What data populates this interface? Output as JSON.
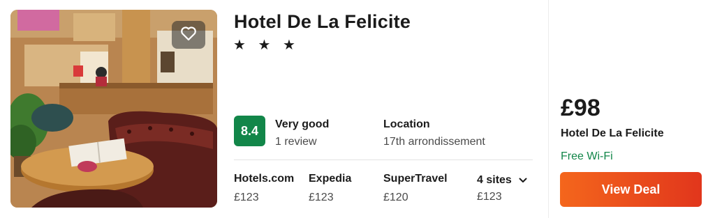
{
  "hotel": {
    "name": "Hotel De La Felicite",
    "stars": "★ ★ ★",
    "favorite_icon": "heart-outline-icon"
  },
  "rating": {
    "score": "8.4",
    "label": "Very good",
    "reviews": "1 review",
    "badge_color": "#128649"
  },
  "location": {
    "label": "Location",
    "value": "17th arrondissement"
  },
  "sites": [
    {
      "name": "Hotels.com",
      "price": "£123"
    },
    {
      "name": "Expedia",
      "price": "£123"
    },
    {
      "name": "SuperTravel",
      "price": "£120"
    }
  ],
  "more_sites": {
    "label": "4 sites",
    "price": "£123",
    "icon": "chevron-down-icon"
  },
  "deal": {
    "price": "£98",
    "site": "Hotel De La Felicite",
    "amenity": "Free Wi-Fi",
    "amenity_color": "#128649",
    "button_label": "View Deal",
    "button_color_start": "#f4661c",
    "button_color_end": "#e1361c"
  }
}
